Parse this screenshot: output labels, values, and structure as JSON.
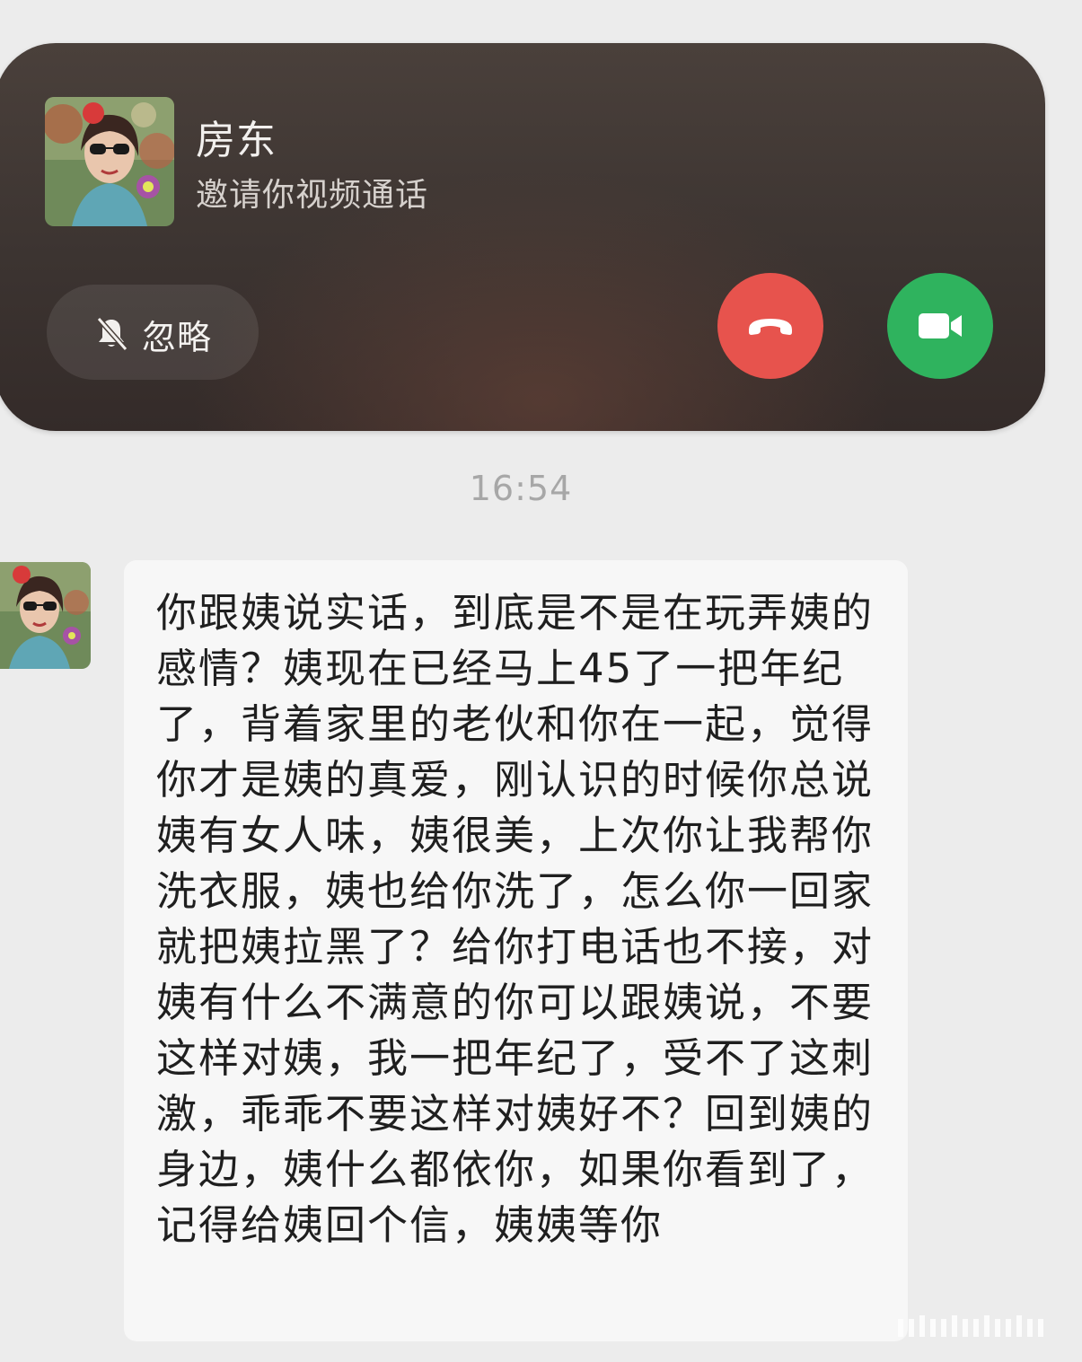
{
  "call": {
    "caller_name": "房东",
    "subtitle": "邀请你视频通话",
    "ignore_label": "忽略",
    "avatar_icon": "caller-avatar-photo",
    "ignore_icon": "bell-off-icon",
    "decline_icon": "phone-hangup-icon",
    "accept_icon": "video-camera-icon",
    "colors": {
      "decline": "#e7534d",
      "accept": "#2fb35e",
      "banner": "#3c3431"
    }
  },
  "chat": {
    "timestamp": "16:54",
    "message": "你跟姨说实话，到底是不是在玩弄姨的感情？姨现在已经马上45了一把年纪了，背着家里的老伙和你在一起，觉得你才是姨的真爱，刚认识的时候你总说姨有女人味，姨很美，上次你让我帮你洗衣服，姨也给你洗了，怎么你一回家就把姨拉黑了？给你打电话也不接，对姨有什么不满意的你可以跟姨说，不要这样对姨，我一把年纪了，受不了这刺激，乖乖不要这样对姨好不？回到姨的身边，姨什么都依你，如果你看到了，记得给姨回个信，姨姨等你"
  }
}
